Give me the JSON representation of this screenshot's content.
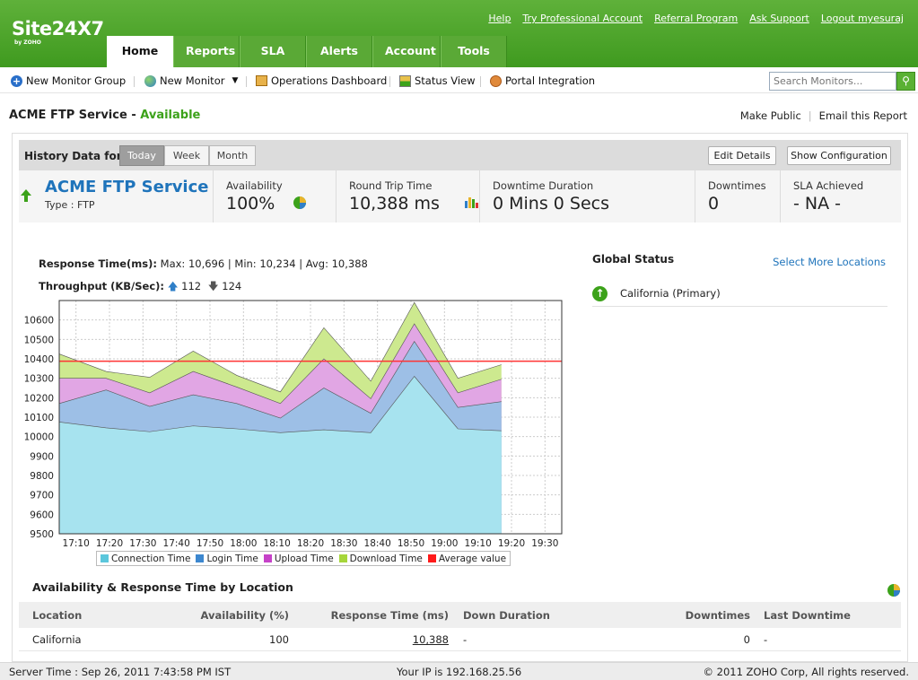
{
  "brand": {
    "logo": "Site24X7",
    "sub": "by ZOHO"
  },
  "toplinks": [
    "Help",
    "Try Professional Account",
    "Referral Program",
    "Ask Support",
    "Logout myesuraj"
  ],
  "tabs": [
    "Home",
    "Reports",
    "SLA",
    "Alerts",
    "Account",
    "Tools"
  ],
  "toolbar": {
    "new_group": "New Monitor Group",
    "new_monitor": "New Monitor",
    "ops_dashboard": "Operations Dashboard",
    "status_view": "Status View",
    "portal": "Portal Integration",
    "search_placeholder": "Search Monitors..."
  },
  "page": {
    "title": "ACME FTP Service",
    "dash": " - ",
    "status": "Available",
    "make_public": "Make Public",
    "email_report": "Email this Report"
  },
  "history": {
    "label": "History Data for:",
    "today": "Today",
    "week": "Week",
    "month": "Month",
    "edit": "Edit Details",
    "config": "Show Configuration"
  },
  "summary": {
    "name": "ACME FTP Service",
    "type": "Type : FTP",
    "availability_label": "Availability",
    "availability": "100%",
    "rtt_label": "Round Trip Time",
    "rtt": "10,388 ms",
    "downtime_label": "Downtime Duration",
    "downtime": "0 Mins 0 Secs",
    "downtimes_label": "Downtimes",
    "downtimes": "0",
    "sla_label": "SLA Achieved",
    "sla": "- NA -"
  },
  "response": {
    "label": "Response Time(ms):",
    "max_label": "Max:",
    "max": "10,696",
    "min_label": "Min:",
    "min": "10,234",
    "avg_label": "Avg:",
    "avg": "10,388",
    "throughput_label": "Throughput (KB/Sec):",
    "up": "112",
    "down": "124"
  },
  "chart_data": {
    "type": "area",
    "stacked": true,
    "x": [
      "17:05",
      "17:15",
      "17:25",
      "17:35",
      "17:45",
      "17:55",
      "18:05",
      "18:15",
      "18:25",
      "18:35",
      "18:45",
      "18:55",
      "19:05",
      "19:15",
      "19:25",
      "19:35"
    ],
    "x_tick_labels": [
      "17:10",
      "17:20",
      "17:30",
      "17:40",
      "17:50",
      "18:00",
      "18:10",
      "18:20",
      "18:30",
      "18:40",
      "18:50",
      "19:00",
      "19:10",
      "19:20",
      "19:30"
    ],
    "ylim": [
      9500,
      10700
    ],
    "yticks": [
      9500,
      9600,
      9700,
      9800,
      9900,
      10000,
      10100,
      10200,
      10300,
      10400,
      10500,
      10600
    ],
    "grid": true,
    "legend_position": "bottom",
    "series": [
      {
        "name": "Connection Time",
        "color": "#a7e3ef",
        "values": [
          10075,
          10045,
          10025,
          10055,
          10040,
          10020,
          10035,
          10020,
          10310,
          10040,
          10030
        ]
      },
      {
        "name": "Login Time",
        "color": "#9dbfe6",
        "values": [
          10170,
          10240,
          10155,
          10215,
          10170,
          10095,
          10250,
          10120,
          10490,
          10150,
          10180
        ]
      },
      {
        "name": "Upload Time",
        "color": "#e1a6e4",
        "values": [
          10300,
          10300,
          10225,
          10335,
          10255,
          10170,
          10400,
          10195,
          10580,
          10225,
          10295
        ]
      },
      {
        "name": "Download Time",
        "color": "#cde98f",
        "values": [
          10425,
          10335,
          10305,
          10440,
          10315,
          10230,
          10560,
          10285,
          10690,
          10300,
          10370
        ]
      },
      {
        "name": "Average value",
        "color": "#ff3333",
        "values": [
          10388
        ]
      }
    ],
    "point_x": [
      "17:05",
      "17:19",
      "17:32",
      "17:45",
      "17:58",
      "18:11",
      "18:24",
      "18:38",
      "18:51",
      "19:04",
      "19:17"
    ]
  },
  "global_status": {
    "title": "Global Status",
    "more": "Select More Locations",
    "location": "California (Primary)"
  },
  "location_table": {
    "title": "Availability & Response Time by Location",
    "headers": [
      "Location",
      "Availability (%)",
      "Response Time (ms)",
      "Down Duration",
      "Downtimes",
      "Last Downtime"
    ],
    "rows": [
      [
        "California",
        "100",
        "10,388",
        "-",
        "0",
        "-"
      ]
    ]
  },
  "footer": {
    "server_time": "Server Time : Sep 26, 2011 7:43:58 PM IST",
    "ip": "Your IP is 192.168.25.56",
    "copyright": "© 2011 ZOHO Corp, All rights reserved."
  }
}
